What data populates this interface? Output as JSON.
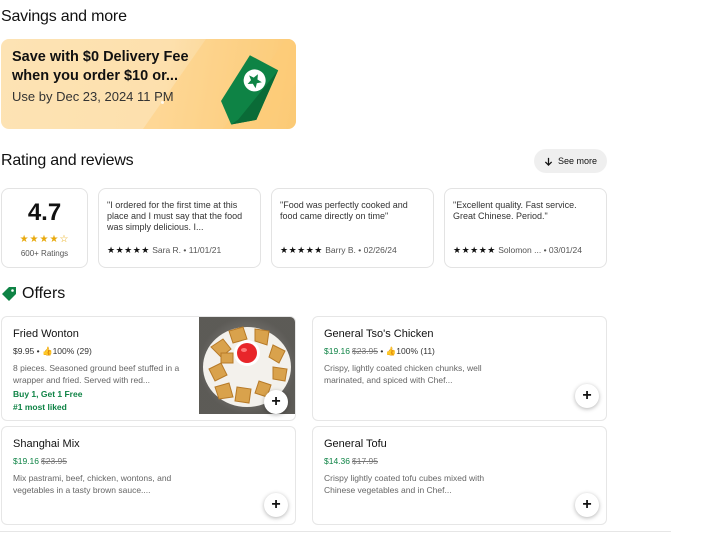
{
  "savings": {
    "heading": "Savings and more",
    "promo_title": "Save with $0 Delivery Fee when you order $10 or...",
    "promo_sub": "Use by Dec 23, 2024 11 PM",
    "tag_color": "#0e8345"
  },
  "ratings": {
    "heading": "Rating and reviews",
    "see_more": "See more",
    "score": "4.7",
    "score_stars": "★★★★☆",
    "count": "600+ Ratings",
    "reviews": [
      {
        "text": "\"I ordered for the first time at this place and I must say that the food was simply delicious. I...",
        "stars": "★★★★★",
        "meta": "Sara R. • 11/01/21"
      },
      {
        "text": "\"Food was perfectly cooked and food came directly on time\"",
        "stars": "★★★★★",
        "meta": "Barry B. • 02/26/24"
      },
      {
        "text": "\"Excellent quality. Fast service. Great Chinese. Period.\"",
        "stars": "★★★★★",
        "meta": "Solomon ... • 03/01/24"
      }
    ]
  },
  "offers": {
    "heading": "Offers",
    "items": [
      {
        "name": "Fried Wonton",
        "price": "$9.95",
        "old_price": "",
        "rating": "100% (29)",
        "desc": "8 pieces. Seasoned ground beef stuffed in a wrapper and fried. Served with red...",
        "promo": "Buy 1, Get 1 Free",
        "badge": "#1 most liked",
        "add": "+"
      },
      {
        "name": "General Tso's Chicken",
        "price": "$19.16",
        "old_price": "$23.95",
        "rating": "100% (11)",
        "desc": "Crispy, lightly coated chicken chunks, well marinated, and spiced with Chef...",
        "add": "+"
      },
      {
        "name": "Shanghai Mix",
        "price": "$19.16",
        "old_price": "$23.95",
        "desc": "Mix pastrami, beef, chicken, wontons, and vegetables in a tasty brown sauce....",
        "add": "+"
      },
      {
        "name": "General Tofu",
        "price": "$14.36",
        "old_price": "$17.95",
        "desc": "Crispy lightly coated tofu cubes mixed with Chinese vegetables and in Chef...",
        "add": "+"
      }
    ]
  },
  "colors": {
    "accent_green": "#0e8345",
    "star_gold": "#e8a90d",
    "promo_bg": "#fde3b4"
  }
}
